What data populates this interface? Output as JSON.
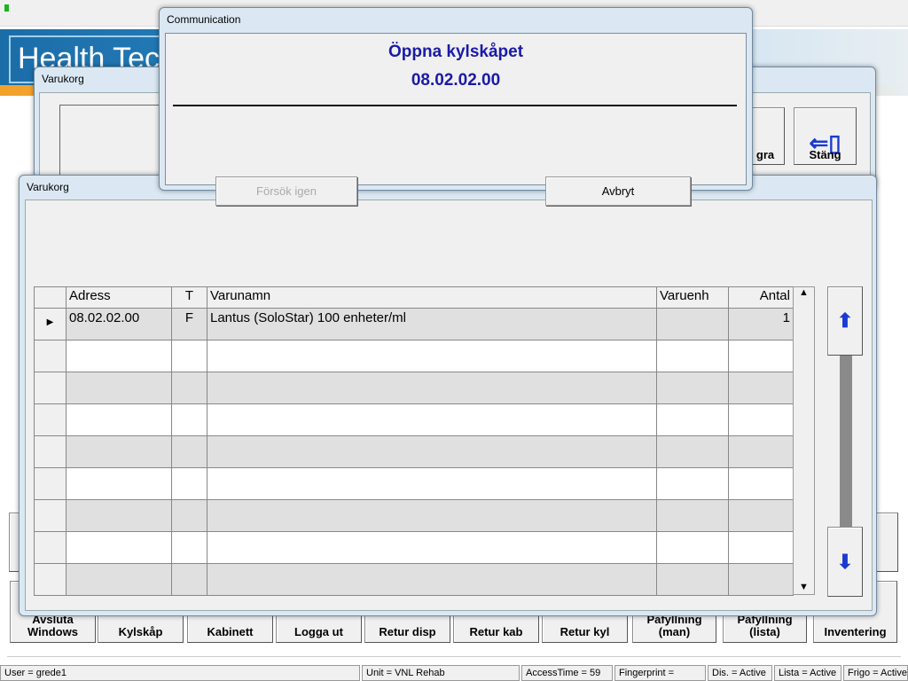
{
  "app": {
    "logo_text": "Health Tec"
  },
  "back_window": {
    "title": "Varukorg",
    "buttons": [
      {
        "label": "gra",
        "icon": "undo-icon"
      },
      {
        "label": "Stäng",
        "icon": "exit-door-icon"
      }
    ]
  },
  "bottom_buttons": [
    "Avsluta Windows",
    "Kylskåp",
    "Kabinett",
    "Logga ut",
    "Retur disp",
    "Retur kab",
    "Retur kyl",
    "Påfyllning (man)",
    "Påfyllning (lista)",
    "Inventering"
  ],
  "status_bar": [
    "User = grede1",
    "Unit = VNL Rehab",
    "AccessTime =  59",
    "Fingerprint =",
    "Dis. = Active",
    "Lista = Active",
    "Frigo = Active"
  ],
  "cart_window": {
    "title": "Varukorg",
    "columns": [
      "Adress",
      "T",
      "Varunamn",
      "Varuenh",
      "Antal"
    ],
    "rows": [
      [
        "08.02.02.00",
        "F",
        "Lantus (SoloStar) 100 enheter/ml",
        "",
        "1"
      ],
      [
        "",
        "",
        "",
        "",
        ""
      ],
      [
        "",
        "",
        "",
        "",
        ""
      ],
      [
        "",
        "",
        "",
        "",
        ""
      ],
      [
        "",
        "",
        "",
        "",
        ""
      ],
      [
        "",
        "",
        "",
        "",
        ""
      ],
      [
        "",
        "",
        "",
        "",
        ""
      ],
      [
        "",
        "",
        "",
        "",
        ""
      ],
      [
        "",
        "",
        "",
        "",
        ""
      ]
    ]
  },
  "dialog": {
    "title": "Communication",
    "message": "Öppna kylskåpet",
    "address": "08.02.02.00",
    "retry_label": "Försök igen",
    "cancel_label": "Avbryt",
    "accent": "#1a1aa8"
  }
}
